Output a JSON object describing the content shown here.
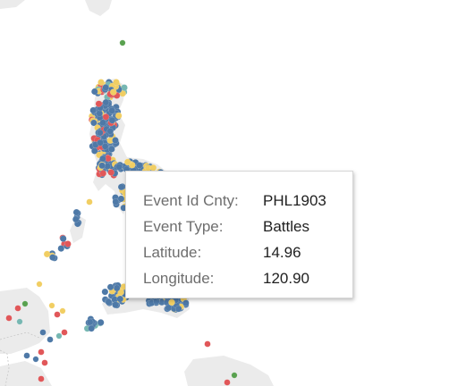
{
  "tooltip": {
    "rows": [
      {
        "label": "Event Id Cnty:",
        "value": "PHL1903"
      },
      {
        "label": "Event Type:",
        "value": "Battles"
      },
      {
        "label": "Latitude:",
        "value": "14.96"
      },
      {
        "label": "Longitude:",
        "value": "120.90"
      }
    ]
  },
  "colors": {
    "land": "#ebebeb",
    "background": "#ffffff",
    "battles": "#4e79a7",
    "violence_against_civilians": "#e15759",
    "protests": "#f1ce63",
    "riots": "#59a14f",
    "strategic_developments": "#76b7b2"
  }
}
